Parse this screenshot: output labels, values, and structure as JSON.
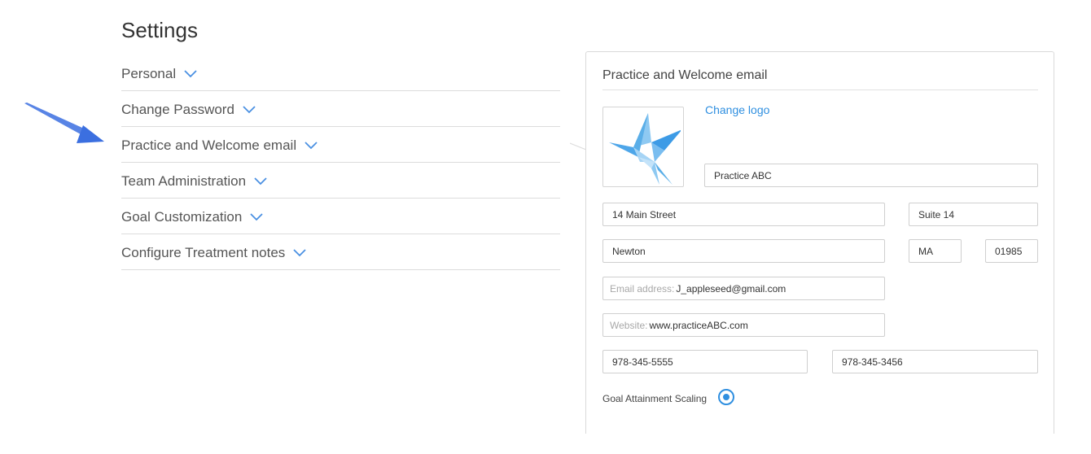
{
  "page": {
    "title": "Settings"
  },
  "settings": {
    "items": [
      {
        "label": "Personal"
      },
      {
        "label": "Change Password"
      },
      {
        "label": "Practice and Welcome email"
      },
      {
        "label": "Team Administration"
      },
      {
        "label": "Goal Customization"
      },
      {
        "label": "Configure Treatment notes"
      }
    ]
  },
  "colors": {
    "accent": "#2f8fe0",
    "arrow": "#3b6fe0",
    "chevron": "#4a90e2"
  },
  "icons": {
    "chevron": "chevron-down-icon",
    "logo": "bird-logo",
    "pointer": "arrow-pointer"
  },
  "panel": {
    "title": "Practice and Welcome email",
    "change_logo": "Change logo",
    "practice_name": "Practice ABC",
    "address1": "14 Main Street",
    "address2": "Suite 14",
    "city": "Newton",
    "state": "MA",
    "zip": "01985",
    "email_placeholder": "Email address:",
    "email": "J_appleseed@gmail.com",
    "website_placeholder": "Website:",
    "website": "www.practiceABC.com",
    "phone1": "978-345-5555",
    "phone2": "978-345-3456",
    "goal_attainment_label": "Goal Attainment Scaling",
    "goal_attainment_selected": true
  }
}
